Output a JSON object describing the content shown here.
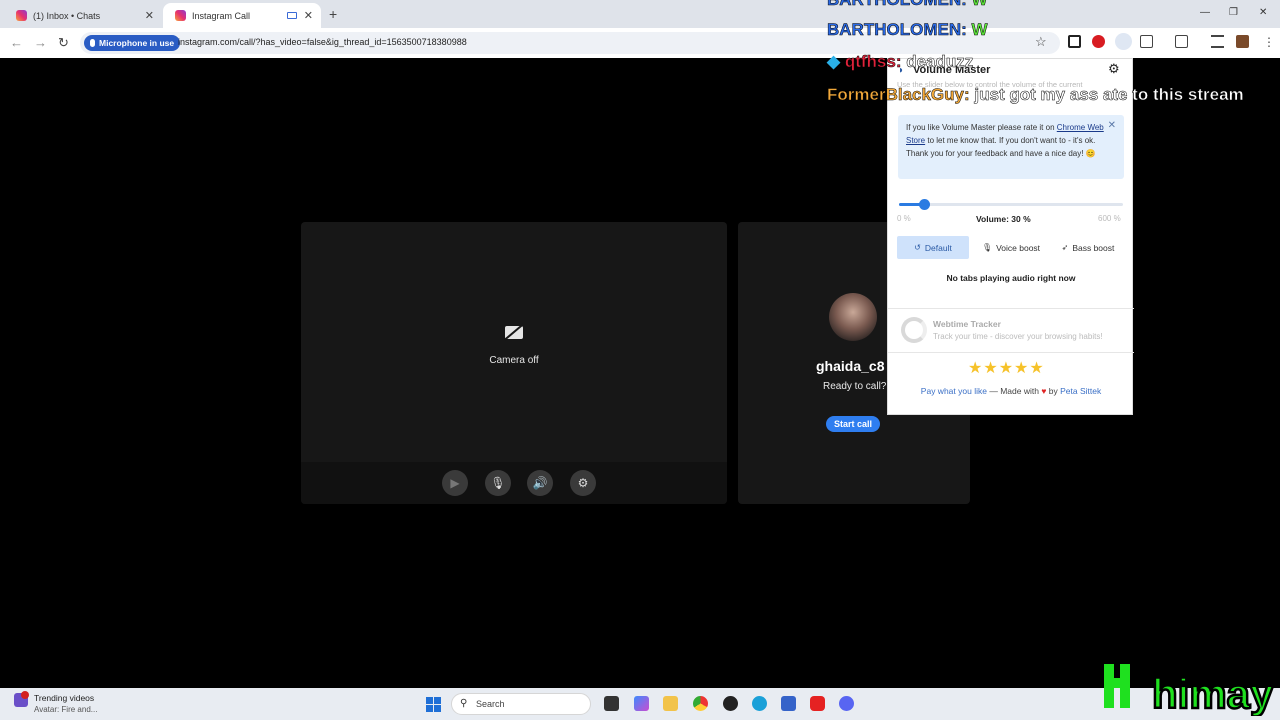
{
  "browser": {
    "tabs": [
      {
        "title": "(1) Inbox • Chats"
      },
      {
        "title": "Instagram Call"
      }
    ],
    "mic_pill": "Microphone in use",
    "url": "instagram.com/call/?has_video=false&ig_thread_id=1563500718380988"
  },
  "call": {
    "camera_off": "Camera off",
    "username": "ghaida_c8",
    "ready": "Ready to call?",
    "start_call": "Start call"
  },
  "overlay_chat": [
    {
      "user": "BARTHOLOMEN:",
      "message": "W",
      "user_color": "#2b6be8",
      "msg_color": "#5de83a"
    },
    {
      "user": "BARTHOLOMEN:",
      "message": "W",
      "user_color": "#2b6be8",
      "msg_color": "#5de83a"
    },
    {
      "user": "qtfhss:",
      "message": "deaduzz",
      "user_color": "#e0223a",
      "msg_color": "#ffffff"
    },
    {
      "user": "FormerBlackGuy:",
      "message": "just got my ass ate to this stream",
      "user_color": "#f3a93a",
      "msg_color": "#ffffff"
    }
  ],
  "volume_master": {
    "title": "Volume Master",
    "subtitle": "Use the slider below to control the volume of the current",
    "note_pre": "If you like Volume Master please rate it on",
    "note_link": "Chrome Web Store",
    "note_post": "to let me know that. If you don't want to - it's ok. Thank you for your feedback and have a nice day! 😊",
    "volume_percent": 30,
    "volume_max_percent": 600,
    "min_label": "0 %",
    "max_label": "600 %",
    "volume_label": "Volume: 30 %",
    "modes": [
      {
        "label": "Default",
        "icon": "reset-icon",
        "selected": true
      },
      {
        "label": "Voice boost",
        "icon": "mic-icon",
        "selected": false
      },
      {
        "label": "Bass boost",
        "icon": "rocket-icon",
        "selected": false
      }
    ],
    "no_tabs": "No tabs playing audio right now",
    "webtime_title": "Webtime Tracker",
    "webtime_sub": "Track your time - discover your browsing habits!",
    "stars": "★★★★★",
    "footer_link1": "Pay what you like",
    "footer_mid": "— Made with",
    "footer_heart": "♥",
    "footer_by": "by",
    "footer_link2": "Peta Sittek"
  },
  "taskbar": {
    "widget_title": "Trending videos",
    "widget_sub": "Avatar: Fire and...",
    "search": "Search"
  },
  "logo_text": "himay"
}
